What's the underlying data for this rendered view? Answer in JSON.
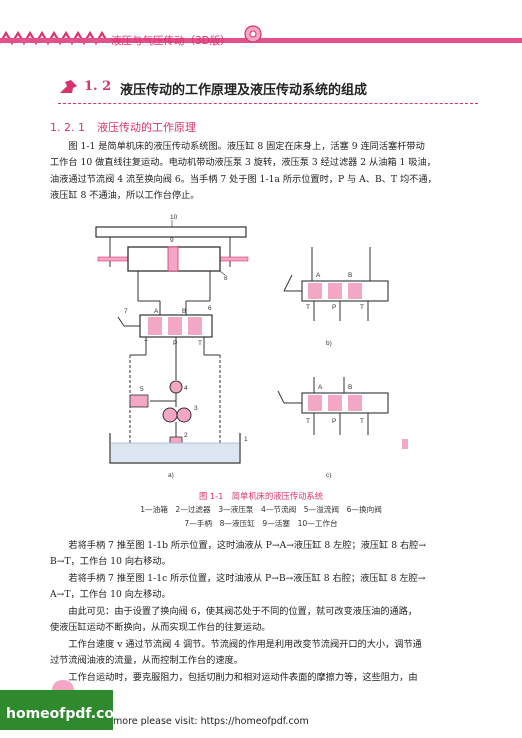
{
  "header": {
    "book_title": "液压与气压传动（3D版）"
  },
  "section": {
    "number": "1. 2",
    "title": "液压传动的工作原理及液压传动系统的组成"
  },
  "subsection": {
    "number": "1. 2. 1",
    "title": "液压传动的工作原理"
  },
  "body_top": {
    "p1_lines": [
      "图 1-1 是简单机床的液压传动系统图。液压缸 8 固定在床身上，活塞 9 连同活塞杆带动",
      "工作台 10 做直线往复运动。电动机带动液压泵 3 旋转，液压泵 3 经过滤器 2 从油箱 1 吸油，",
      "油液通过节流阀 4 流至换向阀 6。当手柄 7 处于图 1-1a 所示位置时，P 与 A、B、T 均不通，",
      "液压缸 8 不通油，所以工作台停止。"
    ]
  },
  "figure": {
    "labels": {
      "n10": "10",
      "n9": "9",
      "n8": "8",
      "n7": "7",
      "n6": "6",
      "n5": "5",
      "n4": "4",
      "n3": "3",
      "n2": "2",
      "n1": "1",
      "A": "A",
      "B": "B",
      "T": "T",
      "P": "P",
      "sub_a": "a)",
      "sub_b": "b)",
      "sub_c": "c)"
    },
    "caption": "图 1-1　简单机床的液压传动系统",
    "legend_line1": "1—油箱　2—过滤器　3—液压泵　4—节流阀　5—溢流阀　6—换向阀",
    "legend_line2": "7—手柄　8—液压缸　9—活塞　10—工作台",
    "colors": {
      "accent": "#d8336f",
      "fill_pink": "#f2a8c5",
      "line": "#333333",
      "oil": "#9fb7d6"
    }
  },
  "body_bottom": {
    "p2_lines": [
      "若将手柄 7 推至图 1-1b 所示位置，这时油液从 P→A→液压缸 8 左腔；液压缸 8 右腔→",
      "B→T，工作台 10 向右移动。"
    ],
    "p3_lines": [
      "若将手柄 7 推至图 1-1c 所示位置，这时油液从 P→B→液压缸 8 右腔；液压缸 8 左腔→",
      "A→T，工作台 10 向左移动。"
    ],
    "p4_lines": [
      "由此可见：由于设置了换向阀 6，使其阀芯处于不同的位置，就可改变液压油的通路，",
      "使液压缸运动不断换向，从而实现工作台的往复运动。"
    ],
    "p5_lines": [
      "工作台速度 v 通过节流阀 4 调节。节流阀的作用是利用改变节流阀开口的大小，调节通",
      "过节流阀油液的流量，从而控制工作台的速度。"
    ],
    "p6_lines": [
      "工作台运动时，要克服阻力，包括切削力和相对运动件表面的摩擦力等，这些阻力，由"
    ]
  },
  "watermark": {
    "logo_text": "homeofpdf.com",
    "footer_text": "more please visit: https://homeofpdf.com"
  }
}
